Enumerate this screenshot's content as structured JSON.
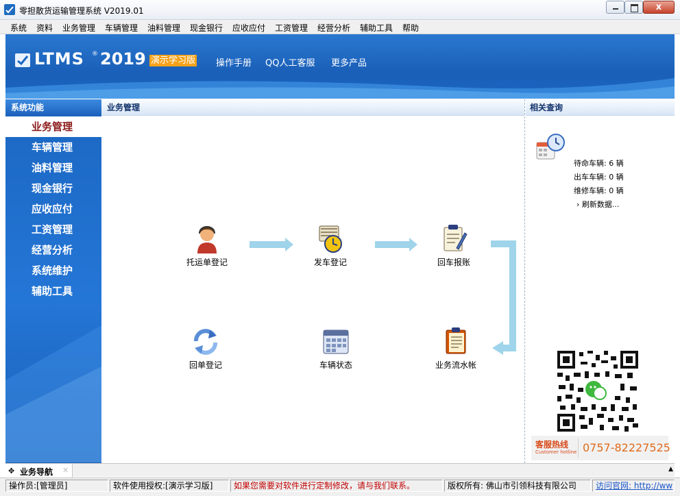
{
  "window": {
    "title": "零担散货运输管理系统 V2019.01",
    "close_label": "x"
  },
  "menubar": {
    "items": [
      "系统",
      "资料",
      "业务管理",
      "车辆管理",
      "油料管理",
      "现金银行",
      "应收应付",
      "工资管理",
      "经营分析",
      "辅助工具",
      "帮助"
    ]
  },
  "banner": {
    "logo_text": "LTMS",
    "logo_reg": "®",
    "logo_year": "2019",
    "edition": "演示学习版",
    "links": [
      "操作手册",
      "QQ人工客服",
      "更多产品"
    ]
  },
  "leftnav": {
    "header": "系统功能",
    "items": [
      "业务管理",
      "车辆管理",
      "油料管理",
      "现金银行",
      "应收应付",
      "工资管理",
      "经营分析",
      "系统维护",
      "辅助工具"
    ],
    "active_index": 0
  },
  "main": {
    "header": "业务管理",
    "flow": [
      {
        "label": "托运单登记",
        "icon": "operator-icon"
      },
      {
        "label": "发车登记",
        "icon": "dispatch-icon"
      },
      {
        "label": "回车报账",
        "icon": "return-report-icon"
      },
      {
        "label": "业务流水帐",
        "icon": "ledger-icon"
      },
      {
        "label": "车辆状态",
        "icon": "vehicle-status-icon"
      },
      {
        "label": "回单登记",
        "icon": "refresh-icon"
      }
    ],
    "arrow_color": "#9fd4ea"
  },
  "right": {
    "header": "相关查询",
    "stats": [
      {
        "label": "待命车辆:",
        "value": "6",
        "unit": "辆"
      },
      {
        "label": "出车车辆:",
        "value": "0",
        "unit": "辆"
      },
      {
        "label": "维修车辆:",
        "value": "0",
        "unit": "辆"
      }
    ],
    "refresh": "› 刷新数据...",
    "hotline_label": "客服热线",
    "hotline_sub": "Customer hotline",
    "hotline_number": "0757-82227525"
  },
  "tabbar": {
    "tab_label": "业务导航",
    "tab_close": "✕"
  },
  "statusbar": {
    "operator": "操作员:[管理员]",
    "license": "软件使用授权:[演示学习版]",
    "notice": "如果您需要对软件进行定制修改，请与我们联系。",
    "copyright": "版权所有: 佛山市引领科技有限公司",
    "website": "访问官网: http://ww"
  },
  "colors": {
    "nav_blue": "#1b66c2",
    "active_text": "#8b1a1a",
    "notice_red": "#c00000",
    "link_blue": "#1a55c8",
    "edition_orange": "#f5a21a"
  }
}
